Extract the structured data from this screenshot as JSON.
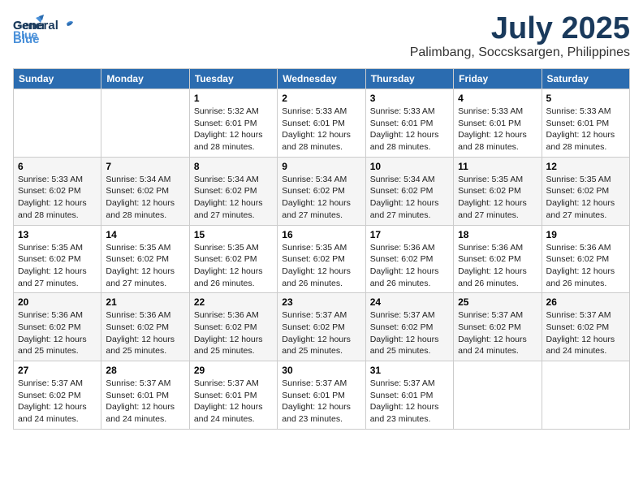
{
  "logo": {
    "line1": "General",
    "line2": "Blue",
    "bird_symbol": "🐦"
  },
  "title": {
    "month_year": "July 2025",
    "location": "Palimbang, Soccsksargen, Philippines"
  },
  "weekdays": [
    "Sunday",
    "Monday",
    "Tuesday",
    "Wednesday",
    "Thursday",
    "Friday",
    "Saturday"
  ],
  "weeks": [
    [
      {
        "day": "",
        "info": ""
      },
      {
        "day": "",
        "info": ""
      },
      {
        "day": "1",
        "info": "Sunrise: 5:32 AM\nSunset: 6:01 PM\nDaylight: 12 hours\nand 28 minutes."
      },
      {
        "day": "2",
        "info": "Sunrise: 5:33 AM\nSunset: 6:01 PM\nDaylight: 12 hours\nand 28 minutes."
      },
      {
        "day": "3",
        "info": "Sunrise: 5:33 AM\nSunset: 6:01 PM\nDaylight: 12 hours\nand 28 minutes."
      },
      {
        "day": "4",
        "info": "Sunrise: 5:33 AM\nSunset: 6:01 PM\nDaylight: 12 hours\nand 28 minutes."
      },
      {
        "day": "5",
        "info": "Sunrise: 5:33 AM\nSunset: 6:01 PM\nDaylight: 12 hours\nand 28 minutes."
      }
    ],
    [
      {
        "day": "6",
        "info": "Sunrise: 5:33 AM\nSunset: 6:02 PM\nDaylight: 12 hours\nand 28 minutes."
      },
      {
        "day": "7",
        "info": "Sunrise: 5:34 AM\nSunset: 6:02 PM\nDaylight: 12 hours\nand 28 minutes."
      },
      {
        "day": "8",
        "info": "Sunrise: 5:34 AM\nSunset: 6:02 PM\nDaylight: 12 hours\nand 27 minutes."
      },
      {
        "day": "9",
        "info": "Sunrise: 5:34 AM\nSunset: 6:02 PM\nDaylight: 12 hours\nand 27 minutes."
      },
      {
        "day": "10",
        "info": "Sunrise: 5:34 AM\nSunset: 6:02 PM\nDaylight: 12 hours\nand 27 minutes."
      },
      {
        "day": "11",
        "info": "Sunrise: 5:35 AM\nSunset: 6:02 PM\nDaylight: 12 hours\nand 27 minutes."
      },
      {
        "day": "12",
        "info": "Sunrise: 5:35 AM\nSunset: 6:02 PM\nDaylight: 12 hours\nand 27 minutes."
      }
    ],
    [
      {
        "day": "13",
        "info": "Sunrise: 5:35 AM\nSunset: 6:02 PM\nDaylight: 12 hours\nand 27 minutes."
      },
      {
        "day": "14",
        "info": "Sunrise: 5:35 AM\nSunset: 6:02 PM\nDaylight: 12 hours\nand 27 minutes."
      },
      {
        "day": "15",
        "info": "Sunrise: 5:35 AM\nSunset: 6:02 PM\nDaylight: 12 hours\nand 26 minutes."
      },
      {
        "day": "16",
        "info": "Sunrise: 5:35 AM\nSunset: 6:02 PM\nDaylight: 12 hours\nand 26 minutes."
      },
      {
        "day": "17",
        "info": "Sunrise: 5:36 AM\nSunset: 6:02 PM\nDaylight: 12 hours\nand 26 minutes."
      },
      {
        "day": "18",
        "info": "Sunrise: 5:36 AM\nSunset: 6:02 PM\nDaylight: 12 hours\nand 26 minutes."
      },
      {
        "day": "19",
        "info": "Sunrise: 5:36 AM\nSunset: 6:02 PM\nDaylight: 12 hours\nand 26 minutes."
      }
    ],
    [
      {
        "day": "20",
        "info": "Sunrise: 5:36 AM\nSunset: 6:02 PM\nDaylight: 12 hours\nand 25 minutes."
      },
      {
        "day": "21",
        "info": "Sunrise: 5:36 AM\nSunset: 6:02 PM\nDaylight: 12 hours\nand 25 minutes."
      },
      {
        "day": "22",
        "info": "Sunrise: 5:36 AM\nSunset: 6:02 PM\nDaylight: 12 hours\nand 25 minutes."
      },
      {
        "day": "23",
        "info": "Sunrise: 5:37 AM\nSunset: 6:02 PM\nDaylight: 12 hours\nand 25 minutes."
      },
      {
        "day": "24",
        "info": "Sunrise: 5:37 AM\nSunset: 6:02 PM\nDaylight: 12 hours\nand 25 minutes."
      },
      {
        "day": "25",
        "info": "Sunrise: 5:37 AM\nSunset: 6:02 PM\nDaylight: 12 hours\nand 24 minutes."
      },
      {
        "day": "26",
        "info": "Sunrise: 5:37 AM\nSunset: 6:02 PM\nDaylight: 12 hours\nand 24 minutes."
      }
    ],
    [
      {
        "day": "27",
        "info": "Sunrise: 5:37 AM\nSunset: 6:02 PM\nDaylight: 12 hours\nand 24 minutes."
      },
      {
        "day": "28",
        "info": "Sunrise: 5:37 AM\nSunset: 6:01 PM\nDaylight: 12 hours\nand 24 minutes."
      },
      {
        "day": "29",
        "info": "Sunrise: 5:37 AM\nSunset: 6:01 PM\nDaylight: 12 hours\nand 24 minutes."
      },
      {
        "day": "30",
        "info": "Sunrise: 5:37 AM\nSunset: 6:01 PM\nDaylight: 12 hours\nand 23 minutes."
      },
      {
        "day": "31",
        "info": "Sunrise: 5:37 AM\nSunset: 6:01 PM\nDaylight: 12 hours\nand 23 minutes."
      },
      {
        "day": "",
        "info": ""
      },
      {
        "day": "",
        "info": ""
      }
    ]
  ]
}
